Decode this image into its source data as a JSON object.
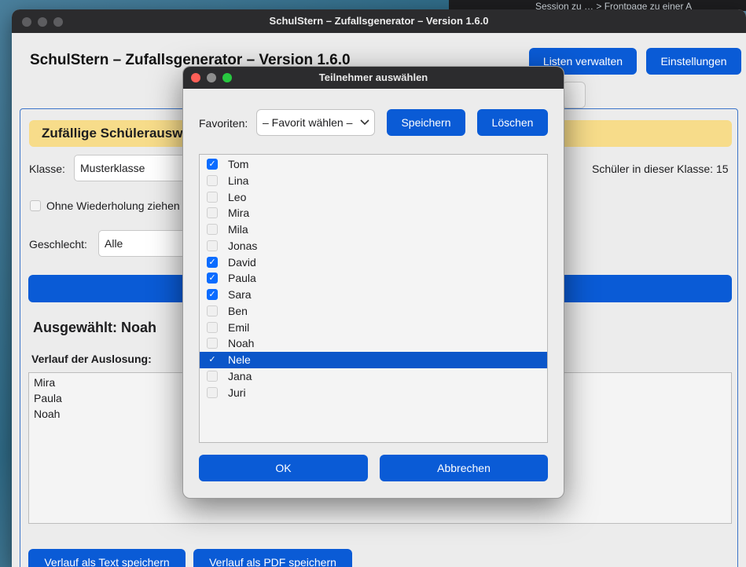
{
  "background": {
    "partial_text": "Session zu … > Frontpage zu einer A"
  },
  "window": {
    "title": "SchulStern – Zufallsgenerator – Version 1.6.0"
  },
  "header": {
    "app_title": "SchulStern – Zufallsgenerator – Version 1.6.0",
    "manage_lists": "Listen verwalten",
    "settings": "Einstellungen"
  },
  "panel": {
    "banner": "Zufällige Schülerausw",
    "class_label": "Klasse:",
    "class_value": "Musterklasse",
    "count_text": "Schüler in dieser Klasse: 15",
    "no_repeat_label": "Ohne Wiederholung ziehen",
    "gender_label": "Geschlecht:",
    "gender_value": "Alle",
    "selected_text": "Ausgewählt: Noah",
    "history_label": "Verlauf der Auslosung:",
    "history": [
      "Mira",
      "Paula",
      "Noah"
    ],
    "save_text": "Verlauf als Text speichern",
    "save_pdf": "Verlauf als PDF speichern"
  },
  "dialog": {
    "title": "Teilnehmer auswählen",
    "favorites_label": "Favoriten:",
    "favorites_value": "– Favorit wählen –",
    "save": "Speichern",
    "delete": "Löschen",
    "ok": "OK",
    "cancel": "Abbrechen",
    "check_glyph": "✓",
    "participants": [
      {
        "name": "Tom",
        "checked": true
      },
      {
        "name": "Lina",
        "checked": false
      },
      {
        "name": "Leo",
        "checked": false
      },
      {
        "name": "Mira",
        "checked": false
      },
      {
        "name": "Mila",
        "checked": false
      },
      {
        "name": "Jonas",
        "checked": false
      },
      {
        "name": "David",
        "checked": true
      },
      {
        "name": "Paula",
        "checked": true
      },
      {
        "name": "Sara",
        "checked": true
      },
      {
        "name": "Ben",
        "checked": false
      },
      {
        "name": "Emil",
        "checked": false
      },
      {
        "name": "Noah",
        "checked": false
      },
      {
        "name": "Nele",
        "checked": true,
        "highlighted": true
      },
      {
        "name": "Jana",
        "checked": false
      },
      {
        "name": "Juri",
        "checked": false
      }
    ]
  },
  "colors": {
    "accent": "#0a5bd6",
    "banner": "#f7dc8a",
    "selection": "#0b56c9"
  }
}
